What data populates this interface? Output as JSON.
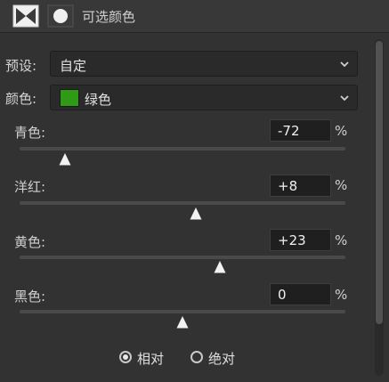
{
  "header": {
    "title": "可选颜色",
    "icons": [
      "adjustment-layer-icon",
      "layer-mask-icon"
    ]
  },
  "preset": {
    "label": "预设:",
    "value": "自定"
  },
  "colors": {
    "label": "颜色:",
    "value": "绿色",
    "swatch_color": "#2f9a16"
  },
  "sliders": [
    {
      "label": "青色:",
      "value": "-72",
      "unit": "%",
      "level": -72
    },
    {
      "label": "洋红:",
      "value": "+8",
      "unit": "%",
      "level": 8
    },
    {
      "label": "黄色:",
      "value": "+23",
      "unit": "%",
      "level": 23
    },
    {
      "label": "黑色:",
      "value": "0",
      "unit": "%",
      "level": 0
    }
  ],
  "method": {
    "options": [
      {
        "label": "相对",
        "checked": true
      },
      {
        "label": "绝对",
        "checked": false
      }
    ]
  }
}
